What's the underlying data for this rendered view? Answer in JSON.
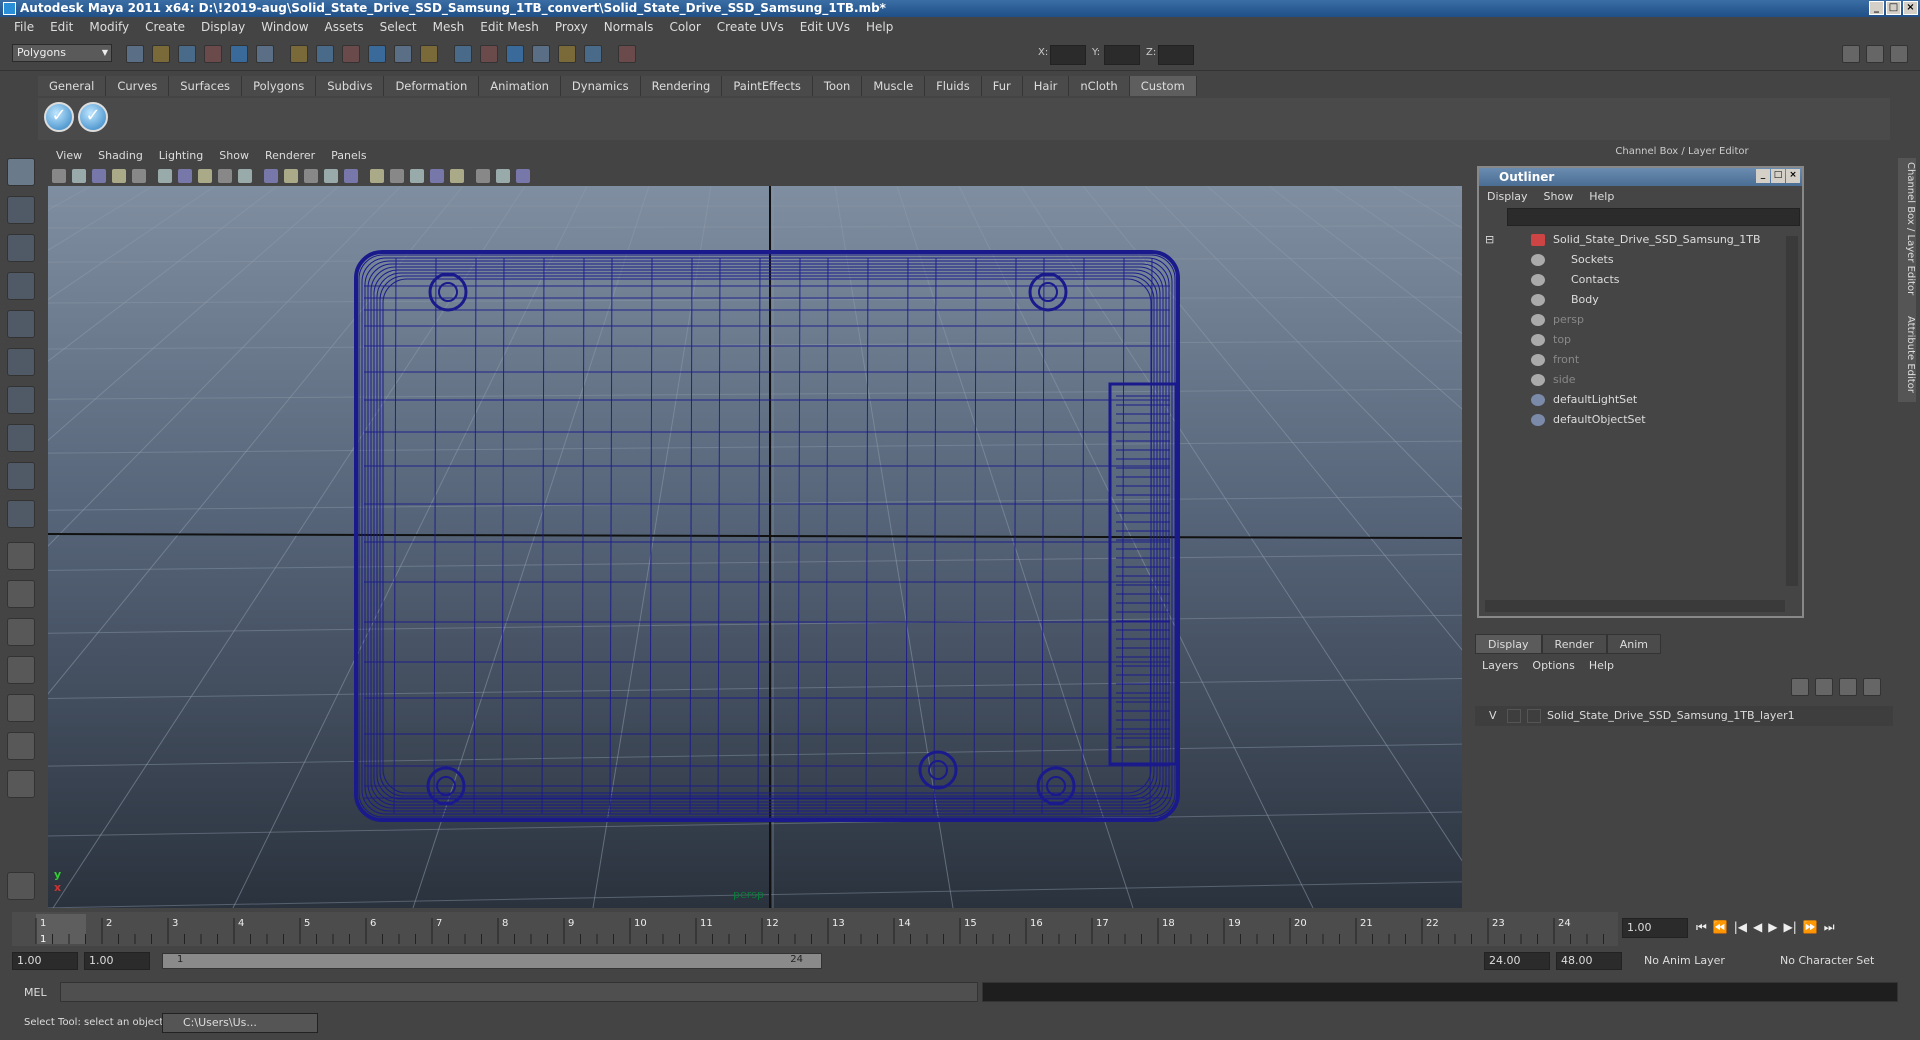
{
  "window": {
    "title": "Autodesk Maya 2011 x64: D:\\!2019-aug\\Solid_State_Drive_SSD_Samsung_1TB_convert\\Solid_State_Drive_SSD_Samsung_1TB.mb*"
  },
  "menubar": [
    "File",
    "Edit",
    "Modify",
    "Create",
    "Display",
    "Window",
    "Assets",
    "Select",
    "Mesh",
    "Edit Mesh",
    "Proxy",
    "Normals",
    "Color",
    "Create UVs",
    "Edit UVs",
    "Help"
  ],
  "statusline": {
    "mode": "Polygons",
    "x_label": "X:",
    "y_label": "Y:",
    "z_label": "Z:"
  },
  "shelf_tabs": [
    "General",
    "Curves",
    "Surfaces",
    "Polygons",
    "Subdivs",
    "Deformation",
    "Animation",
    "Dynamics",
    "Rendering",
    "PaintEffects",
    "Toon",
    "Muscle",
    "Fluids",
    "Fur",
    "Hair",
    "nCloth",
    "Custom"
  ],
  "shelf_active": "Custom",
  "viewport": {
    "menu": [
      "View",
      "Shading",
      "Lighting",
      "Show",
      "Renderer",
      "Panels"
    ],
    "camera_label": "persp",
    "wire_color": "#1a1a8c"
  },
  "channel_box_title": "Channel Box / Layer Editor",
  "side_tabs": [
    "Channel Box / Layer Editor",
    "Attribute Editor"
  ],
  "outliner": {
    "title": "Outliner",
    "menu": [
      "Display",
      "Show",
      "Help"
    ],
    "items": [
      {
        "label": "Solid_State_Drive_SSD_Samsung_1TB",
        "type": "root"
      },
      {
        "label": "Sockets",
        "type": "child"
      },
      {
        "label": "Contacts",
        "type": "child"
      },
      {
        "label": "Body",
        "type": "child"
      },
      {
        "label": "persp",
        "type": "camera"
      },
      {
        "label": "top",
        "type": "camera"
      },
      {
        "label": "front",
        "type": "camera"
      },
      {
        "label": "side",
        "type": "camera"
      },
      {
        "label": "defaultLightSet",
        "type": "set"
      },
      {
        "label": "defaultObjectSet",
        "type": "set"
      }
    ]
  },
  "layer_editor": {
    "tabs": [
      "Display",
      "Render",
      "Anim"
    ],
    "menu": [
      "Layers",
      "Options",
      "Help"
    ],
    "layer_visible": "V",
    "layer_name": "Solid_State_Drive_SSD_Samsung_1TB_layer1"
  },
  "timeline": {
    "ticks": [
      "1",
      "2",
      "3",
      "4",
      "5",
      "6",
      "7",
      "8",
      "9",
      "10",
      "11",
      "12",
      "13",
      "14",
      "15",
      "16",
      "17",
      "18",
      "19",
      "20",
      "21",
      "22",
      "23",
      "24"
    ],
    "current_frame": "1.00",
    "current_marker": "1"
  },
  "range": {
    "start": "1.00",
    "playback_start": "1.00",
    "slider_start": "1",
    "slider_end": "24",
    "playback_end": "24.00",
    "end": "48.00",
    "anim_layer": "No Anim Layer",
    "character_set": "No Character Set"
  },
  "command": {
    "lang": "MEL"
  },
  "help": {
    "text": "Select Tool: select an object",
    "task_item": "C:\\Users\\Us..."
  }
}
